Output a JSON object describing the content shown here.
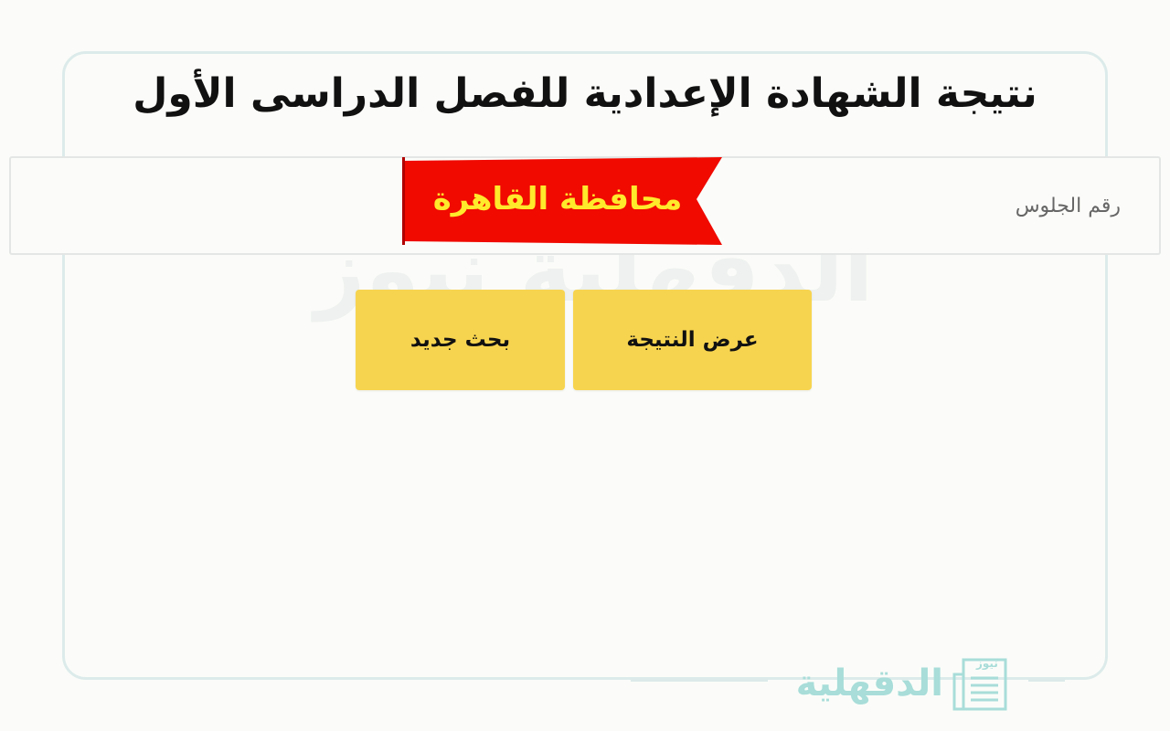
{
  "page": {
    "title": "نتيجة الشهادة الإعدادية للفصل الدراسى الأول",
    "watermark": "الدقهلية نيوز"
  },
  "form": {
    "seat_number_placeholder": "رقم الجلوس",
    "seat_number_value": ""
  },
  "ribbon": {
    "label": "محافظة القاهرة",
    "color": "#f00a00",
    "text_color": "#ffe92b"
  },
  "buttons": {
    "show_result": "عرض النتيجة",
    "new_search": "بحث جديد",
    "color": "#f7d44f"
  },
  "footer": {
    "logo_text": "الدقهلية",
    "logo_small": "نيوز",
    "logo_icon": "newspaper-icon"
  }
}
